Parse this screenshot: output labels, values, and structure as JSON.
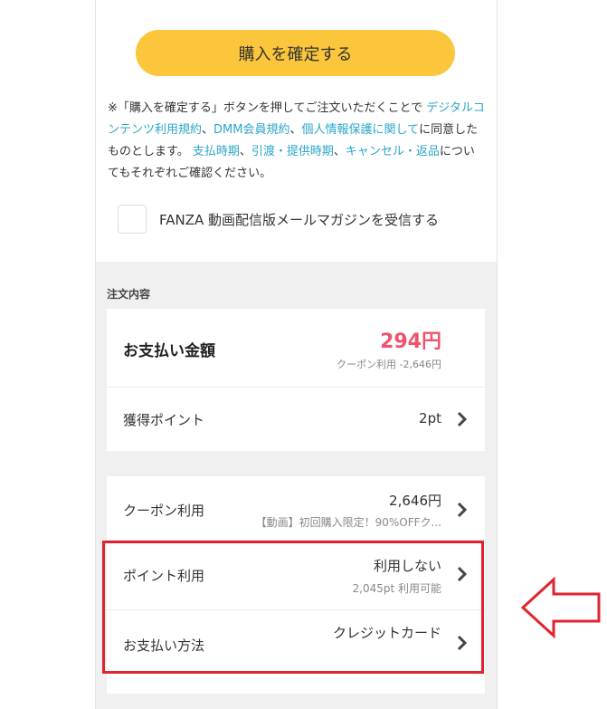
{
  "purchase": {
    "confirm_label": "購入を確定する"
  },
  "notice": {
    "prefix": "※「購入を確定する」ボタンを押してご注文いただくことで",
    "link_terms": "デジタルコンテンツ利用規約",
    "sep1": "、",
    "link_member": "DMM会員規約",
    "sep2": "、",
    "link_privacy": "個人情報保護に関して",
    "agree": "に同意したものとします。",
    "link_payment_timing": "支払時期",
    "sep3": "、",
    "link_delivery": "引渡・提供時期",
    "sep4": "、",
    "link_cancel": "キャンセル・返品",
    "suffix": "についてもそれぞれご確認ください。"
  },
  "newsletter": {
    "label": "FANZA 動画配信版メールマガジンを受信する",
    "checked": false
  },
  "order": {
    "section_title": "注文内容",
    "payment_total_label": "お支払い金額",
    "payment_total_value": "294円",
    "coupon_discount_note": "クーポン利用 -2,646円",
    "points_earned_label": "獲得ポイント",
    "points_earned_value": "2pt",
    "coupon_label": "クーポン利用",
    "coupon_value": "2,646円",
    "coupon_desc": "【動画】初回購入限定！90%OFFク...",
    "points_use_label": "ポイント利用",
    "points_use_value": "利用しない",
    "points_available": "2,045pt 利用可能",
    "payment_method_label": "お支払い方法",
    "payment_method_value": "クレジットカード"
  },
  "colors": {
    "button": "#fbc53c",
    "price": "#f0536e",
    "link": "#2aa6c9",
    "highlight": "#e1232e"
  },
  "icons": {
    "chevron": "chevron-right-icon",
    "arrow": "left-arrow-outline-icon"
  }
}
